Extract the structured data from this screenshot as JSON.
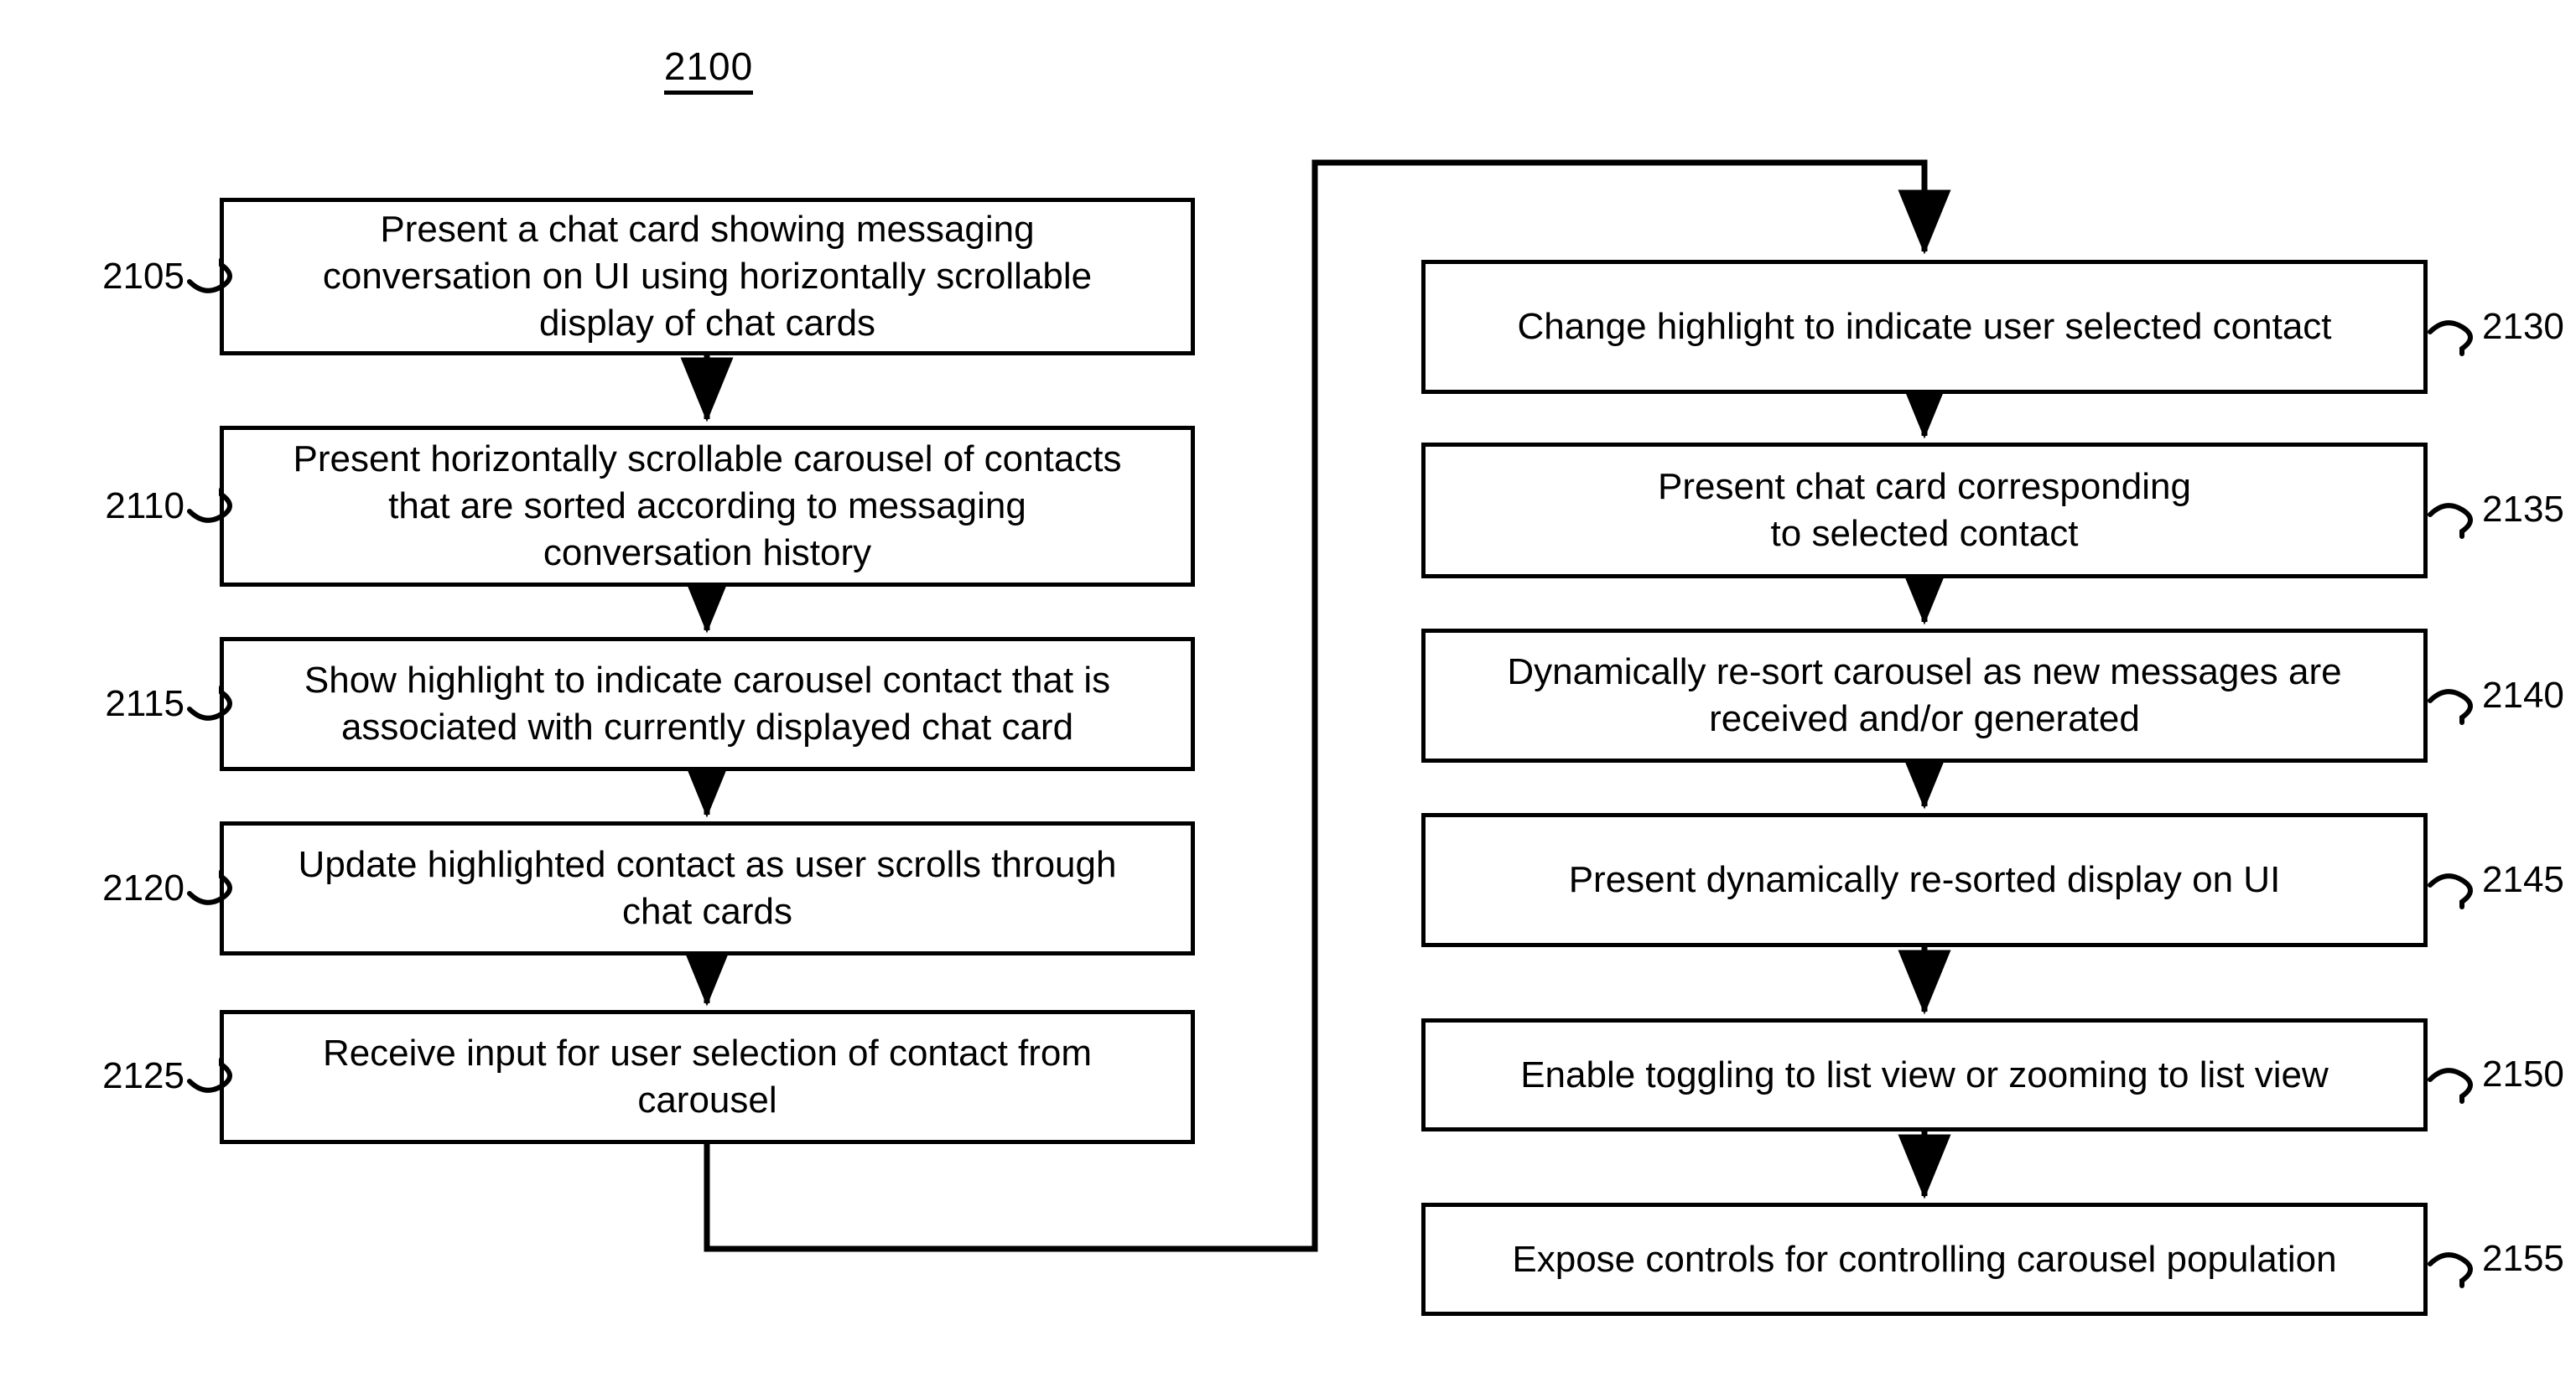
{
  "figure": {
    "number": "2100"
  },
  "boxes": [
    {
      "ref": "2105",
      "text": "Present a chat card showing messaging\nconversation on UI using horizontally scrollable\ndisplay of chat cards",
      "column": "left"
    },
    {
      "ref": "2110",
      "text": "Present horizontally scrollable carousel of contacts\nthat are sorted according to messaging\nconversation history",
      "column": "left"
    },
    {
      "ref": "2115",
      "text": "Show highlight to indicate carousel contact that is\nassociated with currently displayed chat card",
      "column": "left"
    },
    {
      "ref": "2120",
      "text": "Update highlighted contact as user scrolls through\nchat cards",
      "column": "left"
    },
    {
      "ref": "2125",
      "text": "Receive input for user selection of contact from\ncarousel",
      "column": "left"
    },
    {
      "ref": "2130",
      "text": "Change highlight to indicate user selected contact",
      "column": "right"
    },
    {
      "ref": "2135",
      "text": "Present chat card corresponding\nto selected contact",
      "column": "right"
    },
    {
      "ref": "2140",
      "text": "Dynamically re-sort carousel as new messages are\nreceived and/or generated",
      "column": "right"
    },
    {
      "ref": "2145",
      "text": "Present dynamically re-sorted display on UI",
      "column": "right"
    },
    {
      "ref": "2150",
      "text": "Enable toggling to list view or zooming to list view",
      "column": "right"
    },
    {
      "ref": "2155",
      "text": "Expose controls for controlling carousel population",
      "column": "right"
    }
  ],
  "colors": {
    "stroke": "#000000",
    "background": "#ffffff"
  }
}
